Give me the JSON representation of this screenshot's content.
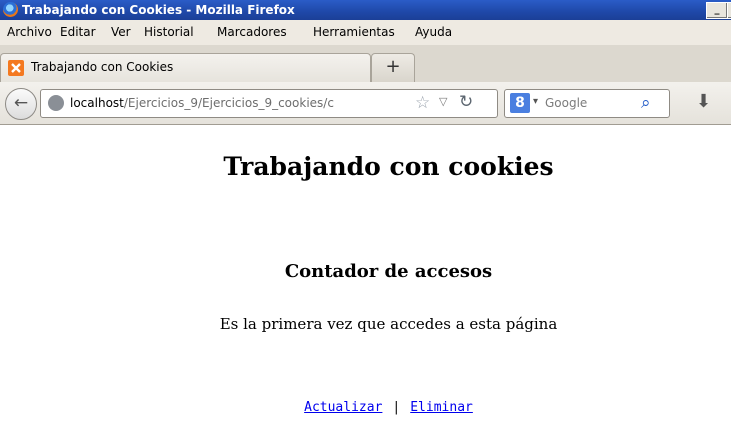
{
  "window": {
    "title": "Trabajando con Cookies - Mozilla Firefox"
  },
  "menu": {
    "items": [
      "Archivo",
      "Editar",
      "Ver",
      "Historial",
      "Marcadores",
      "Herramientas",
      "Ayuda"
    ]
  },
  "tab": {
    "label": "Trabajando con Cookies",
    "new_tab_label": "+"
  },
  "nav": {
    "url_host": "localhost",
    "url_path": "/Ejercicios_9/Ejercicios_9_cookies/c",
    "search_placeholder": "Google",
    "search_engine_icon": "8"
  },
  "page": {
    "title": "Trabajando con cookies",
    "section_title": "Contador de accesos",
    "message": "Es la primera vez que accedes a esta página",
    "link_update": "Actualizar",
    "separator": "|",
    "link_delete": "Eliminar"
  },
  "colors": {
    "titlebar": "#1f48a8",
    "link": "#0000ee",
    "accent_tab_icon": "#f47920"
  }
}
